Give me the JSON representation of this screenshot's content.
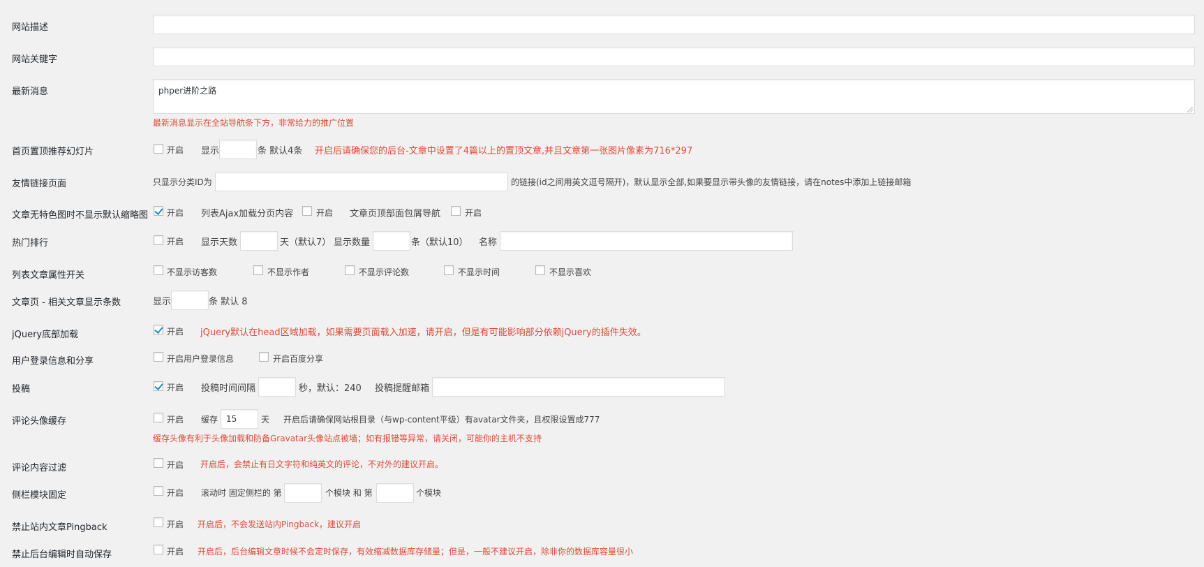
{
  "site_description": {
    "label": "网站描述",
    "value": ""
  },
  "site_keywords": {
    "label": "网站关键字",
    "value": ""
  },
  "latest_news": {
    "label": "最新消息",
    "value": "phper进阶之路",
    "hint": "最新消息显示在全站导航条下方，非常给力的推广位置"
  },
  "home_slider": {
    "label": "首页置顶推荐幻灯片",
    "enable_label": "开启",
    "enabled": false,
    "show_prefix": "显示",
    "count_value": "",
    "suffix": "条 默认4条",
    "hint": "开启后请确保您的后台-文章中设置了4篇以上的置顶文章,并且文章第一张图片像素为716*297"
  },
  "friend_links": {
    "label": "友情链接页面",
    "prefix": "只显示分类ID为",
    "value": "",
    "suffix": "的链接(id之间用英文逗号隔开)，默认显示全部,如果要显示带头像的友情链接，请在notes中添加上链接邮箱"
  },
  "no_thumbnail": {
    "label": "文章无特色图时不显示默认缩略图",
    "enable_label": "开启",
    "enabled": true,
    "ajax_label": "列表Ajax加载分页内容",
    "ajax_enable_label": "开启",
    "ajax_enabled": false,
    "breadcrumb_label": "文章页顶部面包屑导航",
    "breadcrumb_enable_label": "开启",
    "breadcrumb_enabled": false
  },
  "hot_ranking": {
    "label": "热门排行",
    "enable_label": "开启",
    "enabled": false,
    "days_label": "显示天数",
    "days_value": "",
    "days_suffix": "天（默认7）",
    "count_label": "显示数量",
    "count_value": "",
    "count_suffix": "条（默认10）",
    "name_label": "名称",
    "name_value": ""
  },
  "list_attributes": {
    "label": "列表文章属性开关",
    "options": [
      {
        "label": "不显示访客数",
        "checked": false
      },
      {
        "label": "不显示作者",
        "checked": false
      },
      {
        "label": "不显示评论数",
        "checked": false
      },
      {
        "label": "不显示时间",
        "checked": false
      },
      {
        "label": "不显示喜欢",
        "checked": false
      }
    ]
  },
  "related_posts": {
    "label": "文章页 - 相关文章显示条数",
    "prefix": "显示",
    "value": "",
    "suffix": "条 默认 8"
  },
  "jquery_footer": {
    "label": "jQuery底部加载",
    "enable_label": "开启",
    "enabled": true,
    "hint": "jQuery默认在head区域加载，如果需要页面载入加速，请开启，但是有可能影响部分依赖jQuery的插件失效。"
  },
  "user_login_share": {
    "label": "用户登录信息和分享",
    "login_label": "开启用户登录信息",
    "login_enabled": false,
    "share_label": "开启百度分享",
    "share_enabled": false
  },
  "contribute": {
    "label": "投稿",
    "enable_label": "开启",
    "enabled": true,
    "interval_label": "投稿时间间隔",
    "interval_value": "",
    "interval_suffix": "秒，默认：240",
    "email_label": "投稿提醒邮箱",
    "email_value": ""
  },
  "avatar_cache": {
    "label": "评论头像缓存",
    "enable_label": "开启",
    "enabled": false,
    "cache_label": "缓存",
    "cache_value": "15",
    "cache_suffix": "天",
    "note": "开启后请确保网站根目录（与wp-content平级）有avatar文件夹，且权限设置成777",
    "hint": "缓存头像有利于头像加载和防备Gravatar头像站点被墙；如有报错等异常，请关闭，可能你的主机不支持"
  },
  "comment_filter": {
    "label": "评论内容过滤",
    "enable_label": "开启",
    "enabled": false,
    "hint": "开启后，会禁止有日文字符和纯英文的评论，不对外的建议开启。"
  },
  "sidebar_fixed": {
    "label": "侧栏模块固定",
    "enable_label": "开启",
    "enabled": false,
    "prefix": "滚动时 固定侧栏的 第",
    "first_value": "",
    "middle": "个模块 和 第",
    "second_value": "",
    "suffix": "个模块"
  },
  "disable_pingback": {
    "label": "禁止站内文章Pingback",
    "enable_label": "开启",
    "enabled": false,
    "hint": "开启后，不会发送站内Pingback，建议开启"
  },
  "disable_autosave": {
    "label": "禁止后台编辑时自动保存",
    "enable_label": "开启",
    "enabled": false,
    "hint": "开启后，后台编辑文章时候不会定时保存，有效缩减数据库存储量；但是，一般不建议开启，除非你的数据库容量很小"
  },
  "colors": {
    "hint_red": "#dd4b39",
    "check_blue": "#1e8cbe"
  }
}
